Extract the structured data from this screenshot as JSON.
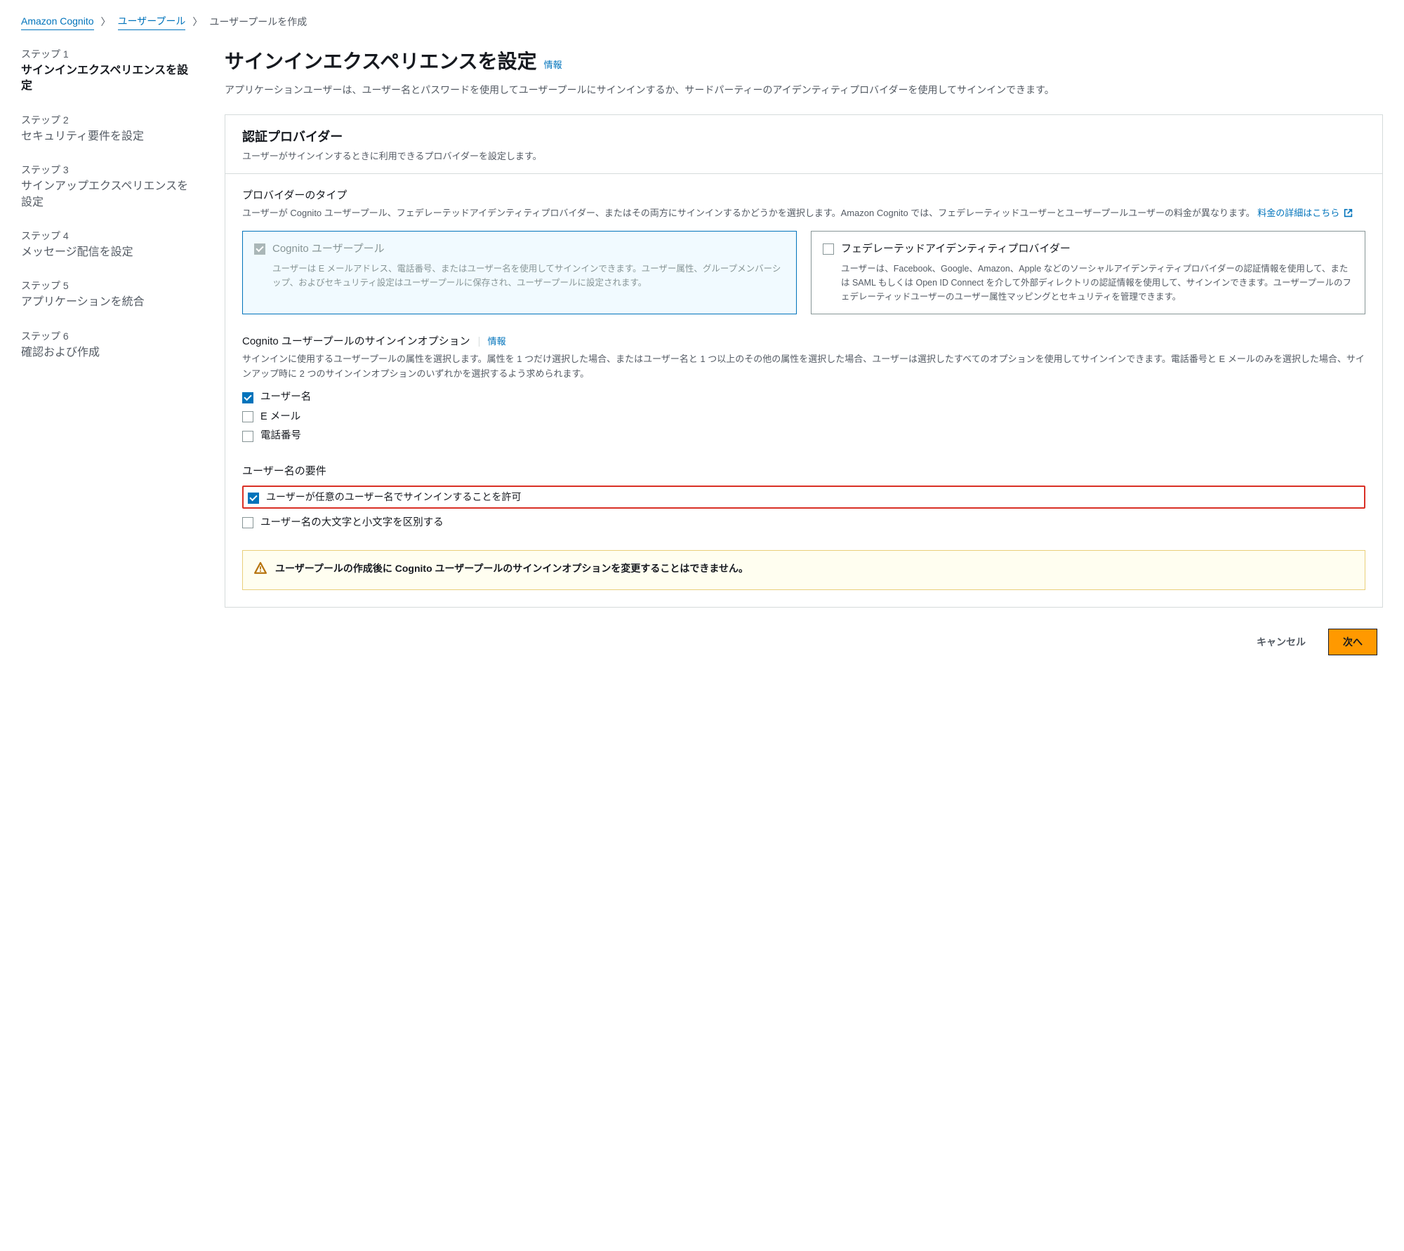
{
  "breadcrumb": {
    "root": "Amazon Cognito",
    "level1": "ユーザープール",
    "current": "ユーザープールを作成"
  },
  "sidebar": {
    "steps": [
      {
        "num": "ステップ 1",
        "title": "サインインエクスペリエンスを設定"
      },
      {
        "num": "ステップ 2",
        "title": "セキュリティ要件を設定"
      },
      {
        "num": "ステップ 3",
        "title": "サインアップエクスペリエンスを設定"
      },
      {
        "num": "ステップ 4",
        "title": "メッセージ配信を設定"
      },
      {
        "num": "ステップ 5",
        "title": "アプリケーションを統合"
      },
      {
        "num": "ステップ 6",
        "title": "確認および作成"
      }
    ]
  },
  "main": {
    "title": "サインインエクスペリエンスを設定",
    "info": "情報",
    "desc": "アプリケーションユーザーは、ユーザー名とパスワードを使用してユーザープールにサインインするか、サードパーティーのアイデンティティプロバイダーを使用してサインインできます。"
  },
  "panel": {
    "title": "認証プロバイダー",
    "sub": "ユーザーがサインインするときに利用できるプロバイダーを設定します。"
  },
  "provider_type": {
    "title": "プロバイダーのタイプ",
    "desc_pre": "ユーザーが Cognito ユーザープール、フェデレーテッドアイデンティティプロバイダー、またはその両方にサインインするかどうかを選択します。Amazon Cognito では、フェデレーティッドユーザーとユーザープールユーザーの料金が異なります。",
    "link": "料金の詳細はこちら",
    "cognito": {
      "title": "Cognito ユーザープール",
      "desc": "ユーザーは E メールアドレス、電話番号、またはユーザー名を使用してサインインできます。ユーザー属性、グループメンバーシップ、およびセキュリティ設定はユーザープールに保存され、ユーザープールに設定されます。"
    },
    "federated": {
      "title": "フェデレーテッドアイデンティティプロバイダー",
      "desc": "ユーザーは、Facebook、Google、Amazon、Apple などのソーシャルアイデンティティプロバイダーの認証情報を使用して、または SAML もしくは Open ID Connect を介して外部ディレクトリの認証情報を使用して、サインインできます。ユーザープールのフェデレーティッドユーザーのユーザー属性マッピングとセキュリティを管理できます。"
    }
  },
  "signin_options": {
    "title": "Cognito ユーザープールのサインインオプション",
    "info": "情報",
    "desc": "サインインに使用するユーザープールの属性を選択します。属性を 1 つだけ選択した場合、またはユーザー名と 1 つ以上のその他の属性を選択した場合、ユーザーは選択したすべてのオプションを使用してサインインできます。電話番号と E メールのみを選択した場合、サインアップ時に 2 つのサインインオプションのいずれかを選択するよう求められます。",
    "username": "ユーザー名",
    "email": "E メール",
    "phone": "電話番号"
  },
  "username_req": {
    "title": "ユーザー名の要件",
    "allow_preferred": "ユーザーが任意のユーザー名でサインインすることを許可",
    "case_sensitive": "ユーザー名の大文字と小文字を区別する"
  },
  "alert": {
    "text": "ユーザープールの作成後に Cognito ユーザープールのサインインオプションを変更することはできません。"
  },
  "footer": {
    "cancel": "キャンセル",
    "next": "次へ"
  }
}
